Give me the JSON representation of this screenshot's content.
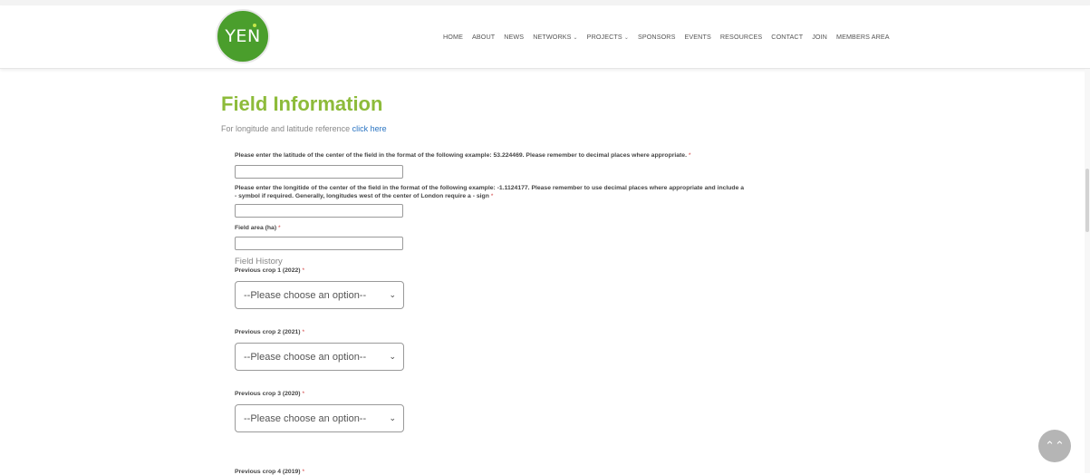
{
  "logo": {
    "text": "YEN"
  },
  "nav": [
    {
      "label": "HOME",
      "dropdown": false
    },
    {
      "label": "ABOUT",
      "dropdown": false
    },
    {
      "label": "NEWS",
      "dropdown": false
    },
    {
      "label": "NETWORKS",
      "dropdown": true
    },
    {
      "label": "PROJECTS",
      "dropdown": true
    },
    {
      "label": "SPONSORS",
      "dropdown": false
    },
    {
      "label": "EVENTS",
      "dropdown": false
    },
    {
      "label": "RESOURCES",
      "dropdown": false
    },
    {
      "label": "CONTACT",
      "dropdown": false
    },
    {
      "label": "JOIN",
      "dropdown": false
    },
    {
      "label": "MEMBERS AREA",
      "dropdown": false
    }
  ],
  "page": {
    "title": "Field Information",
    "intro_text": "For longitude and latitude reference",
    "intro_link": "click here"
  },
  "form": {
    "required_mark": "*",
    "latitude_label": "Please enter the latitude of the center of the field in the format of the following example: 53.224469. Please remember to decimal places where appropriate.",
    "latitude_value": "",
    "longitude_label_line1": "Please enter the longitide of the center of the field in the format of the following example: -1.1124177. Please remember to use decimal places where appropriate and include a",
    "longitude_label_line2": "- symbol if required. Generally, longitudes west of the center of London require a - sign",
    "longitude_value": "",
    "area_label": "Field area (ha)",
    "area_value": "",
    "field_history": "Field History",
    "crop1_label": "Previous crop 1 (2022)",
    "crop1_value": "--Please choose an option--",
    "crop2_label": "Previous crop 2 (2021)",
    "crop2_value": "--Please choose an option--",
    "crop3_label": "Previous crop 3 (2020)",
    "crop3_value": "--Please choose an option--",
    "crop4_label_partial": "Previous crop 4 (2019)"
  },
  "icons": {
    "dropdown_caret": "⌄",
    "select_chevron": "⌄",
    "back_to_top": "⌃⌃"
  },
  "colors": {
    "brand_green": "#4a9e2c",
    "title_green": "#8dbb3a",
    "link_blue": "#2a74c2",
    "required_red": "#d03a3a"
  }
}
